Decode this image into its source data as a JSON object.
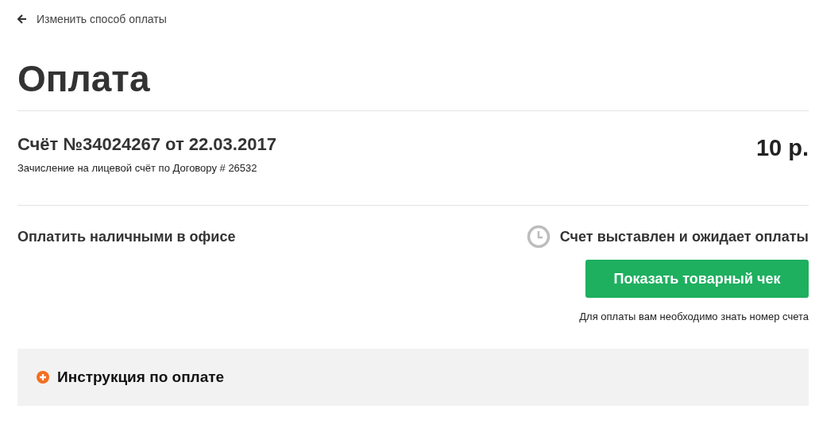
{
  "back_link": {
    "label": "Изменить способ оплаты"
  },
  "title": "Оплата",
  "invoice": {
    "title": "Счёт №34024267 от 22.03.2017",
    "description": "Зачисление на лицевой счёт по Договору # 26532",
    "amount": "10 р."
  },
  "payment": {
    "method": "Оплатить наличными в офисе",
    "status": "Счет выставлен и ожидает оплаты",
    "button": "Показать товарный чек",
    "hint": "Для оплаты вам необходимо знать номер счета"
  },
  "instructions": {
    "label": "Инструкция по оплате",
    "expanded": false
  }
}
